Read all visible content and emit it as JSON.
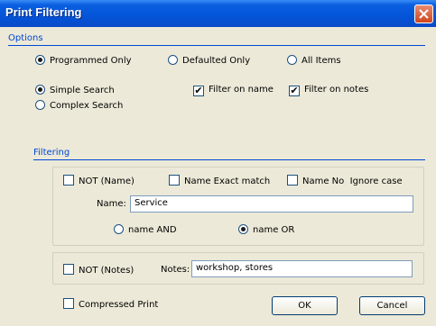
{
  "window": {
    "title": "Print Filtering"
  },
  "options": {
    "label": "Options",
    "radio_programmed": "Programmed Only",
    "radio_defaulted": "Defaulted Only",
    "radio_all": "All Items",
    "radio_simple": "Simple Search",
    "radio_complex": "Complex Search",
    "check_filter_name": "Filter on name",
    "check_filter_notes": "Filter on notes"
  },
  "filtering": {
    "label": "Filtering",
    "not_name": "NOT (Name)",
    "name_exact": "Name Exact match",
    "name_no_ignore": "Name No  Ignore case",
    "name_label": "Name:",
    "name_value": "Service",
    "name_and": "name AND",
    "name_or": "name OR",
    "not_notes": "NOT (Notes)",
    "notes_label": "Notes:",
    "notes_value": "workshop, stores"
  },
  "footer": {
    "compressed_print": "Compressed Print",
    "ok_label": "OK",
    "cancel_label": "Cancel"
  },
  "colors": {
    "title_bar": "#0454d8",
    "section_label": "#0046d5",
    "background": "#ece9d8"
  },
  "icons": {
    "close": "close-icon"
  }
}
